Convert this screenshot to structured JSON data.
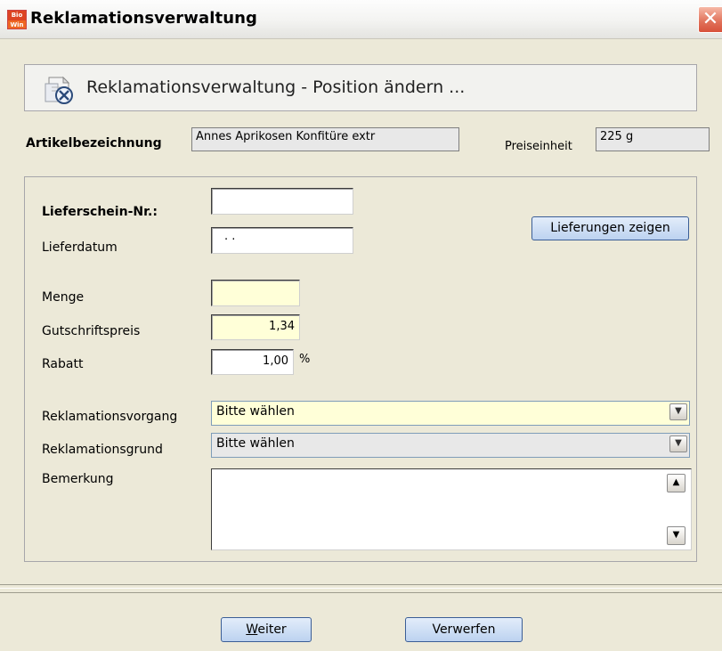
{
  "window": {
    "title": "Reklamationsverwaltung",
    "app_icon_top": "Bio",
    "app_icon_bottom": "Win",
    "close_symbol": "✕"
  },
  "header": {
    "text": "Reklamationsverwaltung - Position ändern ..."
  },
  "article": {
    "label": "Artikelbezeichnung",
    "value": "Annes Aprikosen Konfitüre extr"
  },
  "price_unit": {
    "label": "Preiseinheit",
    "value": "225 g"
  },
  "form": {
    "lieferschein": {
      "label": "Lieferschein-Nr.:",
      "value": ""
    },
    "lieferdatum": {
      "label": "Lieferdatum",
      "value": ". ."
    },
    "menge": {
      "label": "Menge",
      "value": ""
    },
    "gutschriftspreis": {
      "label": "Gutschriftspreis",
      "value": "1,34"
    },
    "rabatt": {
      "label": "Rabatt",
      "value": "1,00",
      "unit": "%"
    },
    "reklamationsvorgang": {
      "label": "Reklamationsvorgang",
      "selected": "Bitte wählen"
    },
    "reklamationsgrund": {
      "label": "Reklamationsgrund",
      "selected": "Bitte wählen"
    },
    "bemerkung": {
      "label": "Bemerkung",
      "value": ""
    },
    "lieferungen_button": "Lieferungen zeigen"
  },
  "footer": {
    "weiter_accel": "W",
    "weiter_rest": "eiter",
    "verwerfen": "Verwerfen"
  },
  "colors": {
    "required_field": "#FFFFD8",
    "button": "#BCD2F0",
    "close": "#D8513A"
  }
}
